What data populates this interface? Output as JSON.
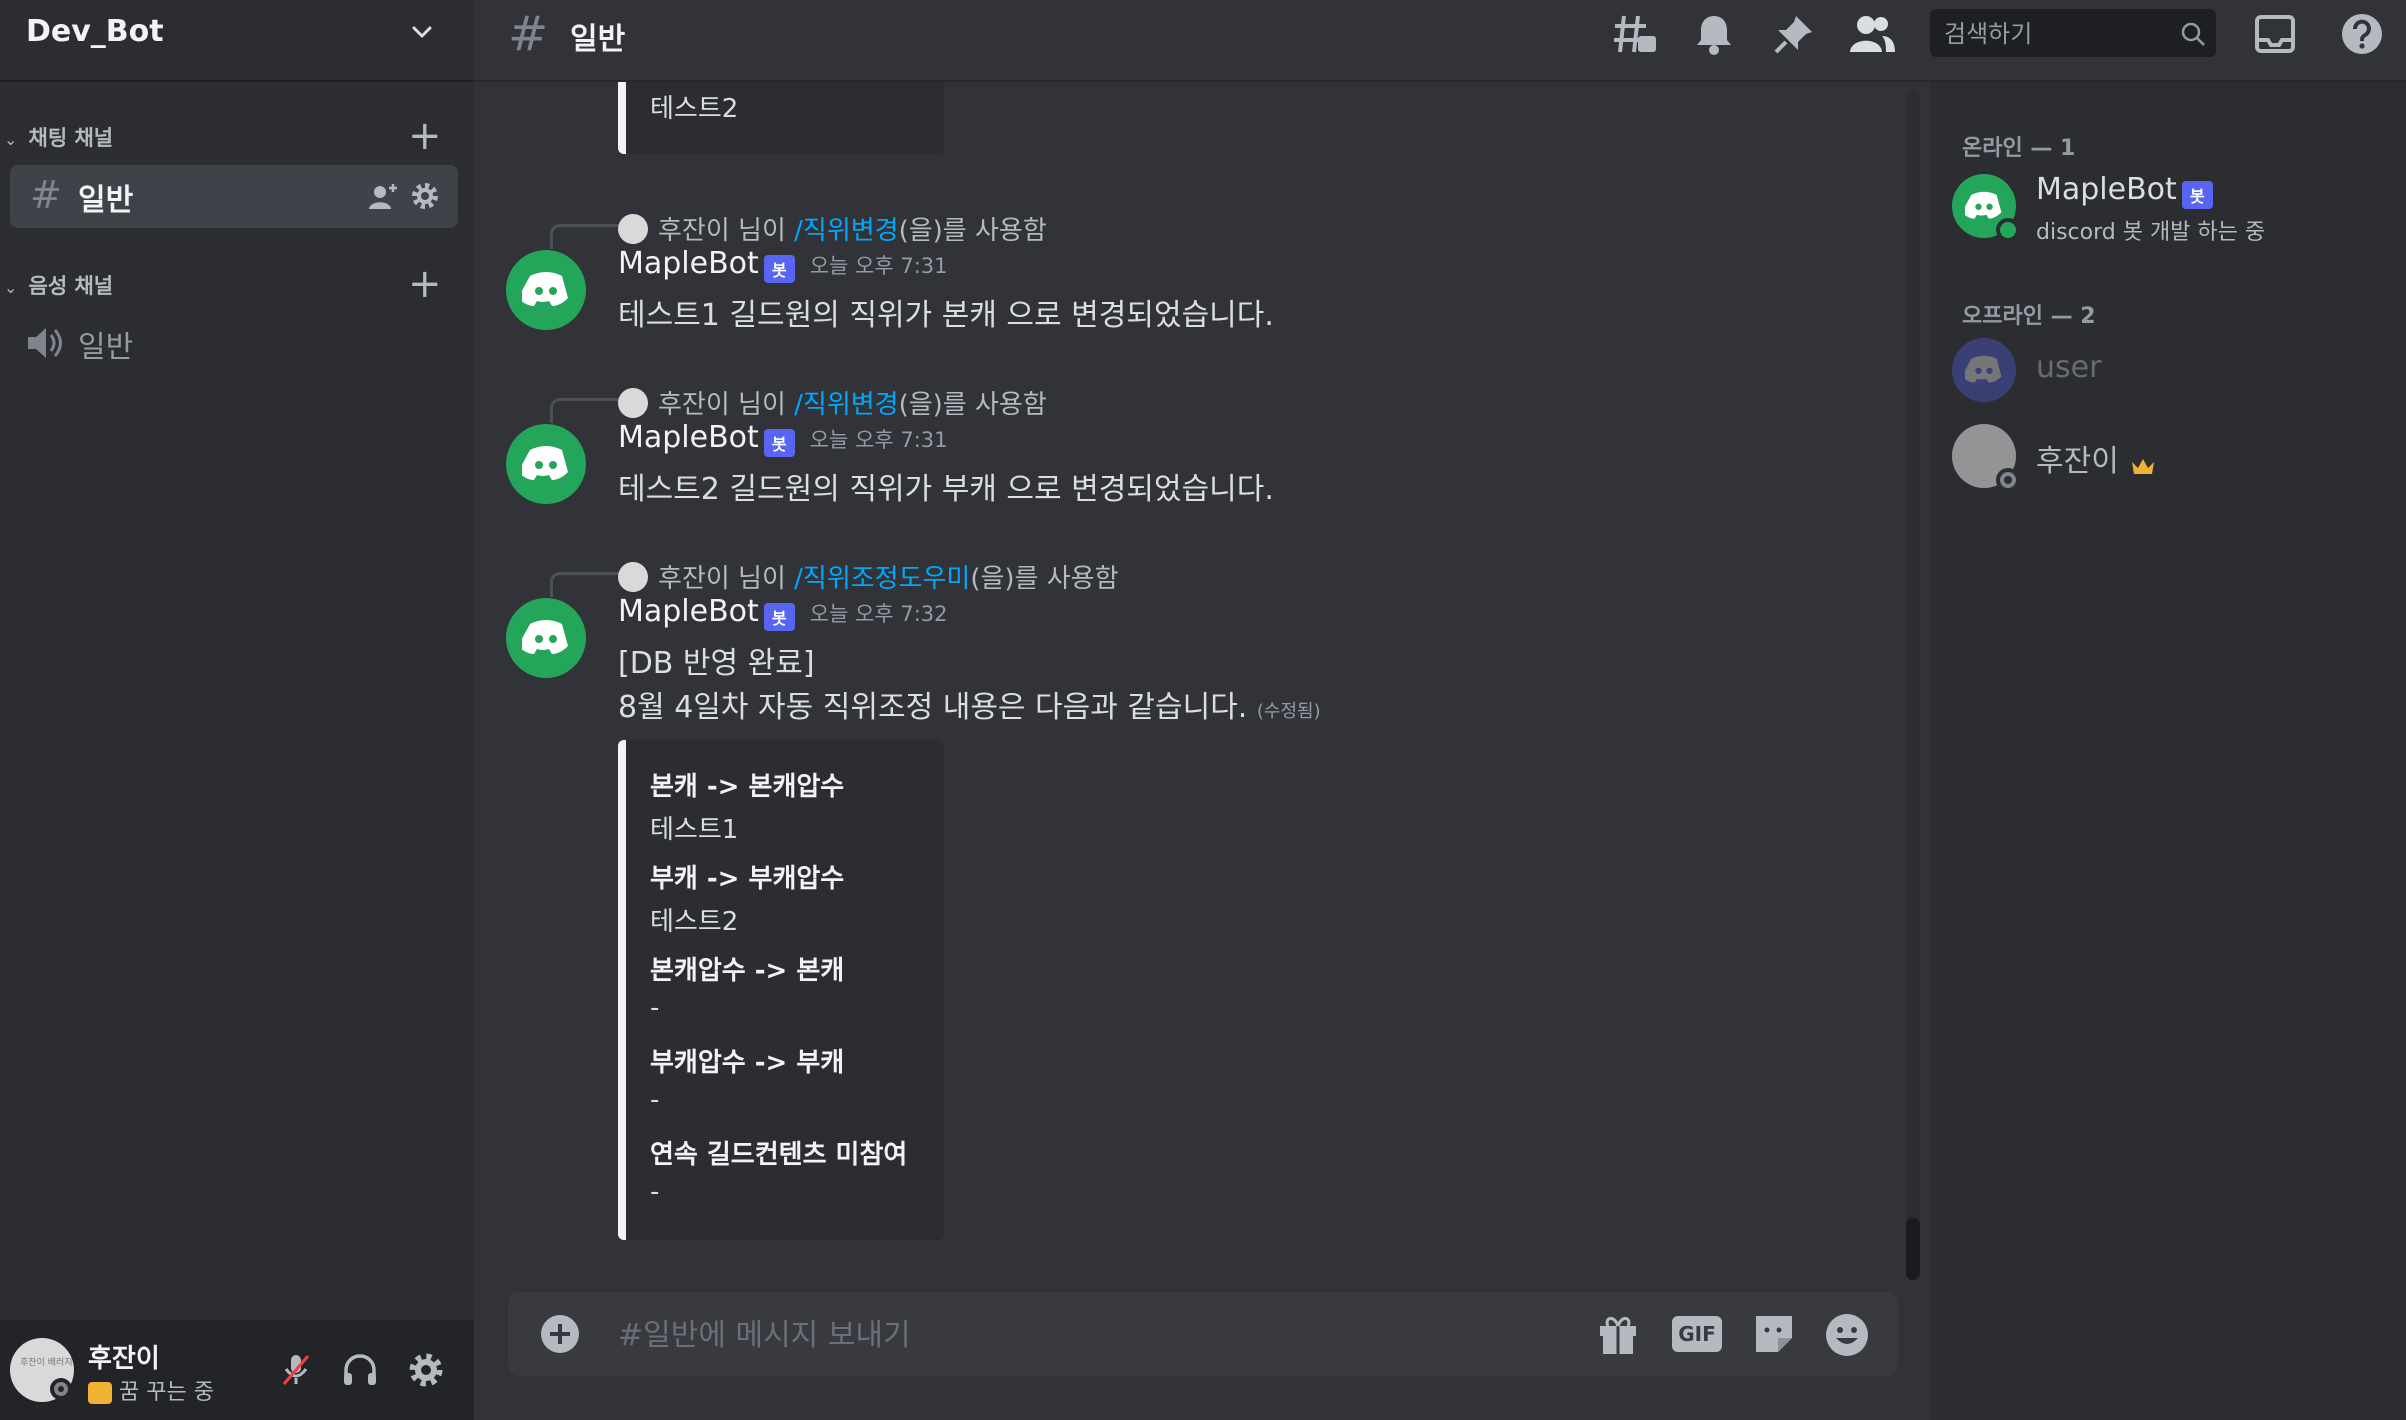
{
  "server": {
    "name": "Dev_Bot"
  },
  "sidebar": {
    "text_category": "채팅 채널",
    "voice_category": "음성 채널",
    "text_channels": [
      {
        "label": "일반"
      }
    ],
    "voice_channels": [
      {
        "label": "일반"
      }
    ]
  },
  "user_panel": {
    "name": "후잔이",
    "status": "꿈 꾸는 중",
    "avatar_text": "후잔이 배러지"
  },
  "header": {
    "channel_name": "일반",
    "search_placeholder": "검색하기"
  },
  "messages": {
    "top_embed_tail": "테스트2",
    "items": [
      {
        "sys_user": "후잔이 님이",
        "sys_command": "/직위변경",
        "sys_suffix": "(을)를 사용함",
        "author": "MapleBot",
        "bot_tag": "봇",
        "time": "오늘 오후 7:31",
        "text": "테스트1 길드원의 직위가 본캐 으로 변경되었습니다."
      },
      {
        "sys_user": "후잔이 님이",
        "sys_command": "/직위변경",
        "sys_suffix": "(을)를 사용함",
        "author": "MapleBot",
        "bot_tag": "봇",
        "time": "오늘 오후 7:31",
        "text": "테스트2 길드원의 직위가 부캐 으로 변경되었습니다."
      },
      {
        "sys_user": "후잔이 님이",
        "sys_command": "/직위조정도우미",
        "sys_suffix": "(을)를 사용함",
        "author": "MapleBot",
        "bot_tag": "봇",
        "time": "오늘 오후 7:32",
        "line1": "[DB 반영 완료]",
        "line2": "8월 4일차 자동 직위조정 내용은 다음과 같습니다.",
        "edited": "(수정됨)",
        "embed_fields": [
          {
            "name": "본캐 -> 본캐압수",
            "value": "테스트1"
          },
          {
            "name": "부캐 -> 부캐압수",
            "value": "테스트2"
          },
          {
            "name": "본캐압수 -> 본캐",
            "value": "-"
          },
          {
            "name": "부캐압수 -> 부캐",
            "value": "-"
          },
          {
            "name": "연속 길드컨텐츠 미참여",
            "value": "-"
          }
        ]
      }
    ]
  },
  "composer": {
    "placeholder": "#일반에 메시지 보내기",
    "gif_label": "GIF"
  },
  "members": {
    "online_header": "온라인 — 1",
    "offline_header": "오프라인 — 2",
    "online": [
      {
        "name": "MapleBot",
        "tag": "봇",
        "activity": "discord 봇 개발 하는 중"
      }
    ],
    "offline": [
      {
        "name": "user"
      },
      {
        "name": "후잔이"
      }
    ]
  },
  "colors": {
    "accent": "#5865f2",
    "bot_green": "#23a55a",
    "link": "#00a8fc",
    "crown": "#f0b232"
  }
}
